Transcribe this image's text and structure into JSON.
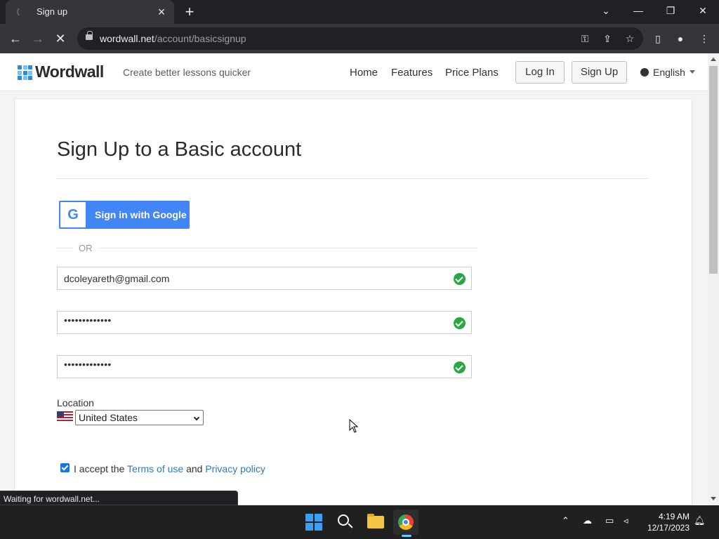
{
  "browser": {
    "tab_title": "Sign up",
    "url_host": "wordwall.net",
    "url_path": "/account/basicsignup",
    "status_text": "Waiting for wordwall.net..."
  },
  "site": {
    "brand": "Wordwall",
    "tagline": "Create better lessons quicker",
    "nav": [
      "Home",
      "Features",
      "Price Plans"
    ],
    "login_label": "Log In",
    "signup_label": "Sign Up",
    "language": "English"
  },
  "form": {
    "title": "Sign Up to a Basic account",
    "google_label": "Sign in with Google",
    "or_label": "OR",
    "email_value": "dcoleyareth@gmail.com",
    "password_value": "•••••••••••••",
    "confirm_value": "•••••••••••••",
    "location_label": "Location",
    "location_value": "United States",
    "accept_prefix": "I accept the",
    "terms_label": "Terms of use",
    "and_label": "and",
    "privacy_label": "Privacy policy",
    "accept_checked": true
  },
  "taskbar": {
    "time": "4:19 AM",
    "date": "12/17/2023"
  },
  "colors": {
    "brand_blue": "#2a8ae6",
    "google_blue": "#4285f4",
    "valid_green": "#27a844",
    "link": "#2f7cb6"
  }
}
